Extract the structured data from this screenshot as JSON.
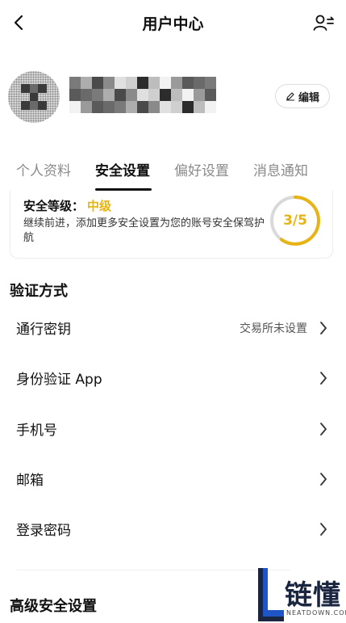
{
  "header": {
    "title": "用户中心",
    "back_icon": "chevron-left-icon",
    "switch_icon": "user-switch-icon"
  },
  "profile": {
    "avatar": "avatar-placeholder",
    "username_state": "pixelated",
    "edit_label": "编辑",
    "edit_icon": "edit-icon"
  },
  "tabs": [
    {
      "label": "个人资料",
      "active": false
    },
    {
      "label": "安全设置",
      "active": true
    },
    {
      "label": "偏好设置",
      "active": false
    },
    {
      "label": "消息通知",
      "active": false
    }
  ],
  "security_level": {
    "label": "安全等级：",
    "value": "中级",
    "description": "继续前进，添加更多安全设置为您的账号安全保驾护航",
    "progress_text": "3/5",
    "progress_fraction": 0.6,
    "accent_color": "#e8b415"
  },
  "verification": {
    "title": "验证方式",
    "items": [
      {
        "label": "通行密钥",
        "value": "交易所未设置"
      },
      {
        "label": "身份验证 App",
        "value": ""
      },
      {
        "label": "手机号",
        "value": ""
      },
      {
        "label": "邮箱",
        "value": ""
      },
      {
        "label": "登录密码",
        "value": ""
      }
    ]
  },
  "advanced": {
    "title": "高级安全设置"
  },
  "watermark": {
    "brand": "链懂",
    "domain": "NEATDOWN.COM"
  }
}
